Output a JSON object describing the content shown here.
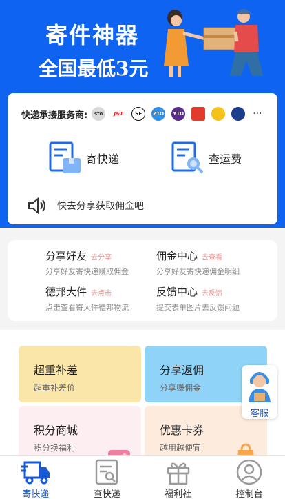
{
  "banner": {
    "title": "寄件神器",
    "subtitle": "全国最低3元"
  },
  "carriers": {
    "label": "快递承接服务商:",
    "items": [
      {
        "icon": "sto-logo",
        "text": "sto",
        "color": "#e0e0e0"
      },
      {
        "icon": "jt-logo",
        "text": "J&T",
        "color": "#ffffff"
      },
      {
        "icon": "sf-logo",
        "text": "SF",
        "color": "#ffffff"
      },
      {
        "icon": "zto-logo",
        "text": "ZTO",
        "color": "#2f8ee8"
      },
      {
        "icon": "yto-logo",
        "text": "YTO",
        "color": "#5a2a8c"
      },
      {
        "icon": "ems-logo",
        "text": "",
        "color": "#e13b2d"
      },
      {
        "icon": "yunda-logo",
        "text": "",
        "color": "#f5c21b"
      },
      {
        "icon": "best-logo",
        "text": "",
        "color": "#1c3c8c"
      }
    ],
    "more": "···"
  },
  "actions": {
    "send_label": "寄快递",
    "fee_label": "查运费"
  },
  "notice": {
    "text": "快去分享获取佣金吧"
  },
  "share_panel": {
    "items": [
      {
        "title": "分享好友",
        "go": "去分享",
        "desc": "分享好友寄快递赚取佣金"
      },
      {
        "title": "佣金中心",
        "go": "去查看",
        "desc": "分享好友寄快递佣金明细"
      },
      {
        "title": "德邦大件",
        "go": "去点击",
        "desc": "点击查看寄大件德邦物流"
      },
      {
        "title": "反馈中心",
        "go": "去反馈",
        "desc": "提交表单图片去反馈问题"
      }
    ]
  },
  "tiles": [
    {
      "title": "超重补差",
      "desc": "超重补差价"
    },
    {
      "title": "分享返佣",
      "desc": "分享赚佣金"
    },
    {
      "title": "积分商城",
      "desc": "积分换福利"
    },
    {
      "title": "优惠卡券",
      "desc": "越用越便宜"
    }
  ],
  "service": {
    "label": "客服"
  },
  "tabbar": {
    "items": [
      {
        "label": "寄快递",
        "icon": "truck-icon",
        "active": true
      },
      {
        "label": "查快递",
        "icon": "search-doc-icon",
        "active": false
      },
      {
        "label": "福利社",
        "icon": "gift-icon",
        "active": false
      },
      {
        "label": "控制台",
        "icon": "user-icon",
        "active": false
      }
    ]
  },
  "colors": {
    "brand_blue": "#0f63f1",
    "active_tab": "#1659d6",
    "link_pink": "#f08a8a"
  }
}
